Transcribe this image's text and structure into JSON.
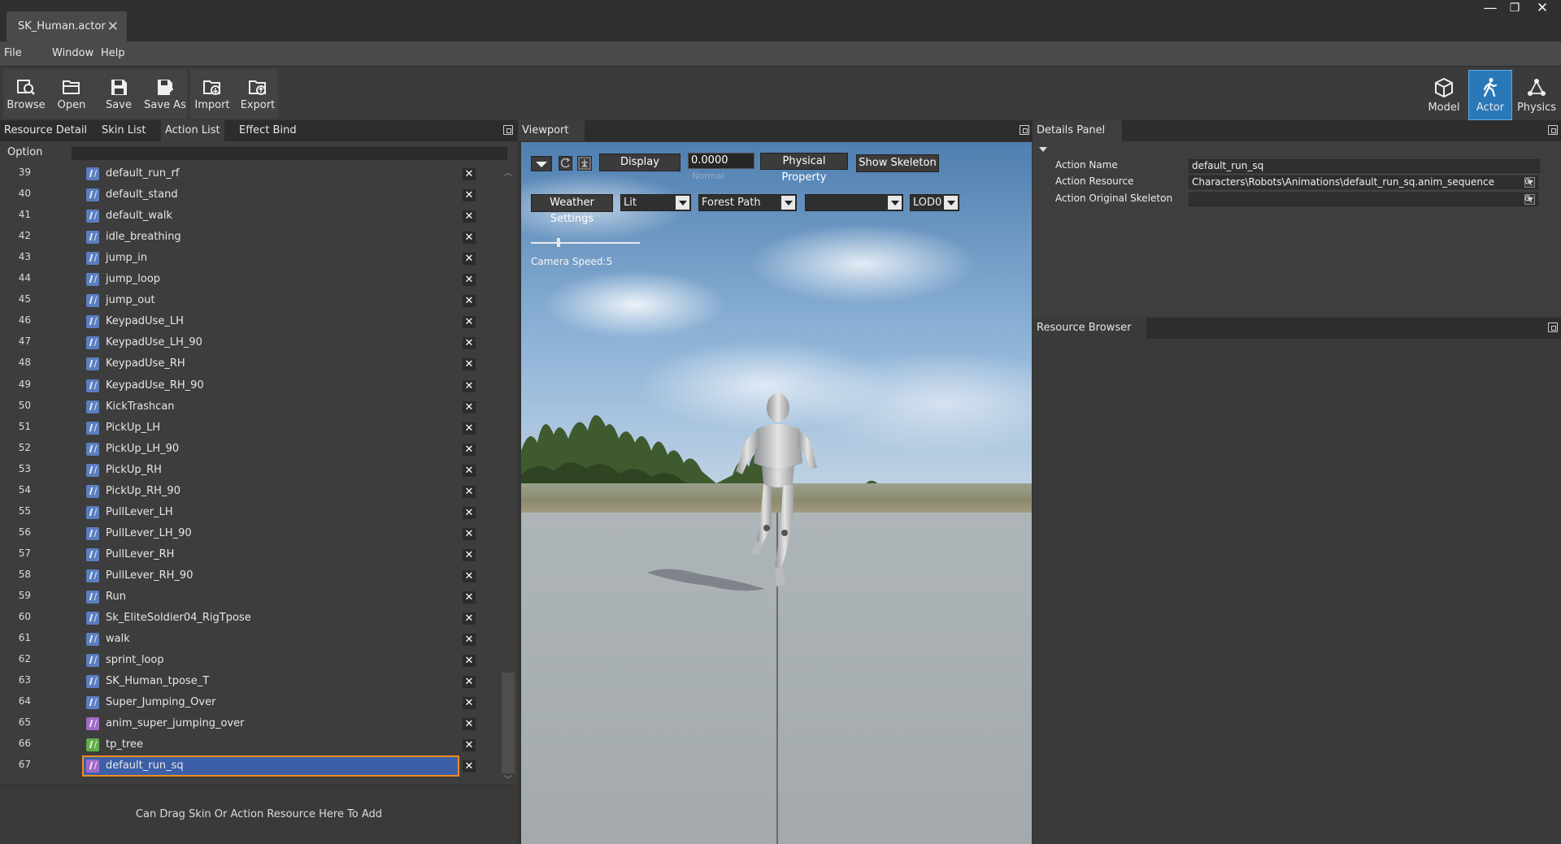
{
  "window": {
    "tab_title": "SK_Human.actor",
    "minimize": "—",
    "restore": "❐",
    "close": "✕"
  },
  "menu": [
    "File",
    "Window",
    "Help"
  ],
  "toolbar": {
    "buttons": [
      {
        "label": "Browse",
        "icon": "browse-icon"
      },
      {
        "label": "Open",
        "icon": "folder-open-icon"
      },
      {
        "label": "Save",
        "icon": "save-icon"
      },
      {
        "label": "Save As",
        "icon": "save-as-icon"
      },
      {
        "label": "Import",
        "icon": "import-icon"
      },
      {
        "label": "Export",
        "icon": "export-icon"
      }
    ],
    "modes": [
      {
        "label": "Model",
        "icon": "cube-icon",
        "active": false
      },
      {
        "label": "Actor",
        "icon": "walking-figure-icon",
        "active": true
      },
      {
        "label": "Physics",
        "icon": "physics-nodes-icon",
        "active": false
      }
    ],
    "active_color": "#2b78b8"
  },
  "left_panel": {
    "tabs": [
      "Resource Detail",
      "Skin List",
      "Action List",
      "Effect Bind"
    ],
    "active_tab": "Action List",
    "option_label": "Option",
    "selected_index": 67,
    "actions": [
      {
        "n": "39",
        "name": "default_run_rf",
        "type": "blue"
      },
      {
        "n": "40",
        "name": "default_stand",
        "type": "blue"
      },
      {
        "n": "41",
        "name": "default_walk",
        "type": "blue"
      },
      {
        "n": "42",
        "name": "idle_breathing",
        "type": "blue"
      },
      {
        "n": "43",
        "name": "jump_in",
        "type": "blue"
      },
      {
        "n": "44",
        "name": "jump_loop",
        "type": "blue"
      },
      {
        "n": "45",
        "name": "jump_out",
        "type": "blue"
      },
      {
        "n": "46",
        "name": "KeypadUse_LH",
        "type": "blue"
      },
      {
        "n": "47",
        "name": "KeypadUse_LH_90",
        "type": "blue"
      },
      {
        "n": "48",
        "name": "KeypadUse_RH",
        "type": "blue"
      },
      {
        "n": "49",
        "name": "KeypadUse_RH_90",
        "type": "blue"
      },
      {
        "n": "50",
        "name": "KickTrashcan",
        "type": "blue"
      },
      {
        "n": "51",
        "name": "PickUp_LH",
        "type": "blue"
      },
      {
        "n": "52",
        "name": "PickUp_LH_90",
        "type": "blue"
      },
      {
        "n": "53",
        "name": "PickUp_RH",
        "type": "blue"
      },
      {
        "n": "54",
        "name": "PickUp_RH_90",
        "type": "blue"
      },
      {
        "n": "55",
        "name": "PullLever_LH",
        "type": "blue"
      },
      {
        "n": "56",
        "name": "PullLever_LH_90",
        "type": "blue"
      },
      {
        "n": "57",
        "name": "PullLever_RH",
        "type": "blue"
      },
      {
        "n": "58",
        "name": "PullLever_RH_90",
        "type": "blue"
      },
      {
        "n": "59",
        "name": "Run",
        "type": "blue"
      },
      {
        "n": "60",
        "name": "Sk_EliteSoldier04_RigTpose",
        "type": "blue"
      },
      {
        "n": "61",
        "name": "walk",
        "type": "blue"
      },
      {
        "n": "62",
        "name": "sprint_loop",
        "type": "blue"
      },
      {
        "n": "63",
        "name": "SK_Human_tpose_T",
        "type": "blue"
      },
      {
        "n": "64",
        "name": "Super_Jumping_Over",
        "type": "blue"
      },
      {
        "n": "65",
        "name": "anim_super_jumping_over",
        "type": "purple"
      },
      {
        "n": "66",
        "name": "tp_tree",
        "type": "green"
      },
      {
        "n": "67",
        "name": "default_run_sq",
        "type": "purple"
      }
    ],
    "delete_glyph": "✕",
    "hint": "Can Drag Skin Or Action Resource Here To Add"
  },
  "viewport": {
    "title": "Viewport",
    "display_label": "Display",
    "time_value": "0.0000",
    "time_sub": "Normal",
    "physical_property": "Physical Property",
    "show_skeleton": "Show Skeleton",
    "weather_settings": "Weather Settings",
    "lighting_mode": "Lit",
    "environment": "Forest Path",
    "extra_option": "",
    "lod": "LOD0",
    "camera_speed": "Camera Speed:5",
    "camera_speed_value": 5
  },
  "details": {
    "title": "Details Panel",
    "action_name_label": "Action Name",
    "action_name": "default_run_sq",
    "action_resource_label": "Action Resource",
    "action_resource": "Characters\\Robots\\Animations\\default_run_sq.anim_sequence",
    "original_skeleton_label": "Action Original Skeleton",
    "original_skeleton": ""
  },
  "resource_browser": {
    "title": "Resource Browser"
  }
}
